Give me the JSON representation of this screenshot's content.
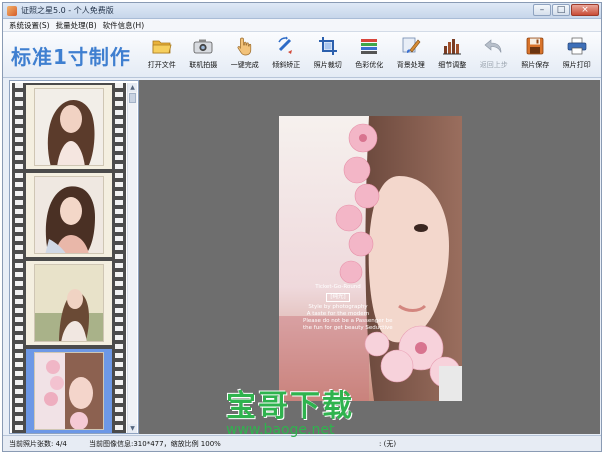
{
  "window": {
    "title": "证照之星5.0 - 个人免费版",
    "controls": [
      "minimize",
      "maximize",
      "close"
    ]
  },
  "menu": [
    "系统设置(S)",
    "批量处理(B)",
    "软件信息(H)"
  ],
  "toolbar": {
    "mode_title": "标准1寸制作",
    "tools": [
      {
        "label": "打开文件",
        "icon": "folder-open-icon",
        "enabled": true
      },
      {
        "label": "联机拍摄",
        "icon": "camera-icon",
        "enabled": true
      },
      {
        "label": "一键完成",
        "icon": "hand-click-icon",
        "enabled": true
      },
      {
        "label": "倾斜矫正",
        "icon": "rotate-correct-icon",
        "enabled": true
      },
      {
        "label": "照片裁切",
        "icon": "crop-icon",
        "enabled": true
      },
      {
        "label": "色彩优化",
        "icon": "color-bars-icon",
        "enabled": true
      },
      {
        "label": "背景处理",
        "icon": "background-brush-icon",
        "enabled": true
      },
      {
        "label": "细节调整",
        "icon": "detail-adjust-icon",
        "enabled": true
      },
      {
        "label": "返回上步",
        "icon": "undo-icon",
        "enabled": false
      },
      {
        "label": "照片保存",
        "icon": "save-icon",
        "enabled": true
      },
      {
        "label": "照片打印",
        "icon": "printer-icon",
        "enabled": true
      }
    ]
  },
  "filmstrip": {
    "thumbnails": [
      {
        "name": "thumb-1",
        "selected": false
      },
      {
        "name": "thumb-2",
        "selected": false
      },
      {
        "name": "thumb-3",
        "selected": false
      },
      {
        "name": "thumb-4",
        "selected": true
      }
    ]
  },
  "photo": {
    "caption_lines": [
      "Ticket-Go-Round",
      "[纯光]",
      "Style by photography",
      "A taste for the modern",
      "Please do not be a Passenger be",
      "the fun for get beauty Seductive"
    ],
    "caption_tag": "[纯光]"
  },
  "watermark": {
    "title": "宝哥下载",
    "url": "www.baoge.net"
  },
  "status": {
    "photo_count": "当前照片张数: 4/4",
    "image_info": "当前图像信息:310*477，缩放比例 100%",
    "extra": ": (无)"
  },
  "colors": {
    "accent_blue": "#3f7fd0",
    "watermark_green": "#2fb34e",
    "canvas_gray": "#6e6e6e",
    "selected_thumb": "#6d98e6"
  }
}
